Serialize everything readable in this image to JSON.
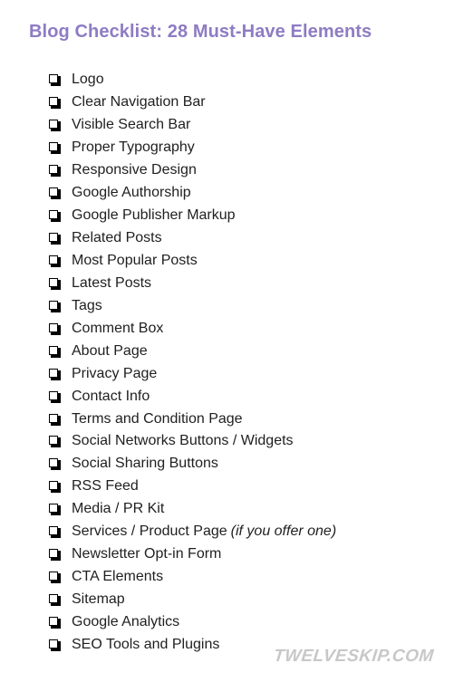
{
  "title": "Blog Checklist: 28 Must-Have Elements",
  "icons": {
    "checkbox": "checkbox-icon"
  },
  "colors": {
    "title": "#8e7cc3",
    "text": "#1f1f1f",
    "watermark": "#c8c8c8"
  },
  "checklist": {
    "items": [
      {
        "label": "Logo",
        "note": "",
        "checked": false
      },
      {
        "label": "Clear Navigation Bar",
        "note": "",
        "checked": false
      },
      {
        "label": "Visible Search Bar",
        "note": "",
        "checked": false
      },
      {
        "label": "Proper Typography",
        "note": "",
        "checked": false
      },
      {
        "label": "Responsive Design",
        "note": "",
        "checked": false
      },
      {
        "label": "Google Authorship",
        "note": "",
        "checked": false
      },
      {
        "label": "Google Publisher Markup",
        "note": "",
        "checked": false
      },
      {
        "label": "Related Posts",
        "note": "",
        "checked": false
      },
      {
        "label": "Most Popular Posts",
        "note": "",
        "checked": false
      },
      {
        "label": "Latest Posts",
        "note": "",
        "checked": false
      },
      {
        "label": "Tags",
        "note": "",
        "checked": false
      },
      {
        "label": "Comment Box",
        "note": "",
        "checked": false
      },
      {
        "label": "About Page",
        "note": "",
        "checked": false
      },
      {
        "label": "Privacy Page",
        "note": "",
        "checked": false
      },
      {
        "label": "Contact Info",
        "note": "",
        "checked": false
      },
      {
        "label": "Terms and Condition Page",
        "note": "",
        "checked": false
      },
      {
        "label": "Social Networks Buttons / Widgets",
        "note": "",
        "checked": false
      },
      {
        "label": "Social Sharing Buttons",
        "note": "",
        "checked": false
      },
      {
        "label": "RSS Feed",
        "note": "",
        "checked": false
      },
      {
        "label": "Media / PR Kit",
        "note": "",
        "checked": false
      },
      {
        "label": "Services / Product Page",
        "note": "(if you offer one)",
        "checked": false
      },
      {
        "label": "Newsletter Opt-in Form",
        "note": "",
        "checked": false
      },
      {
        "label": "CTA Elements",
        "note": "",
        "checked": false
      },
      {
        "label": "Sitemap",
        "note": "",
        "checked": false
      },
      {
        "label": "Google Analytics",
        "note": "",
        "checked": false
      },
      {
        "label": "SEO Tools and Plugins",
        "note": "",
        "checked": false
      }
    ]
  },
  "watermark": "TWELVESKIP.COM"
}
